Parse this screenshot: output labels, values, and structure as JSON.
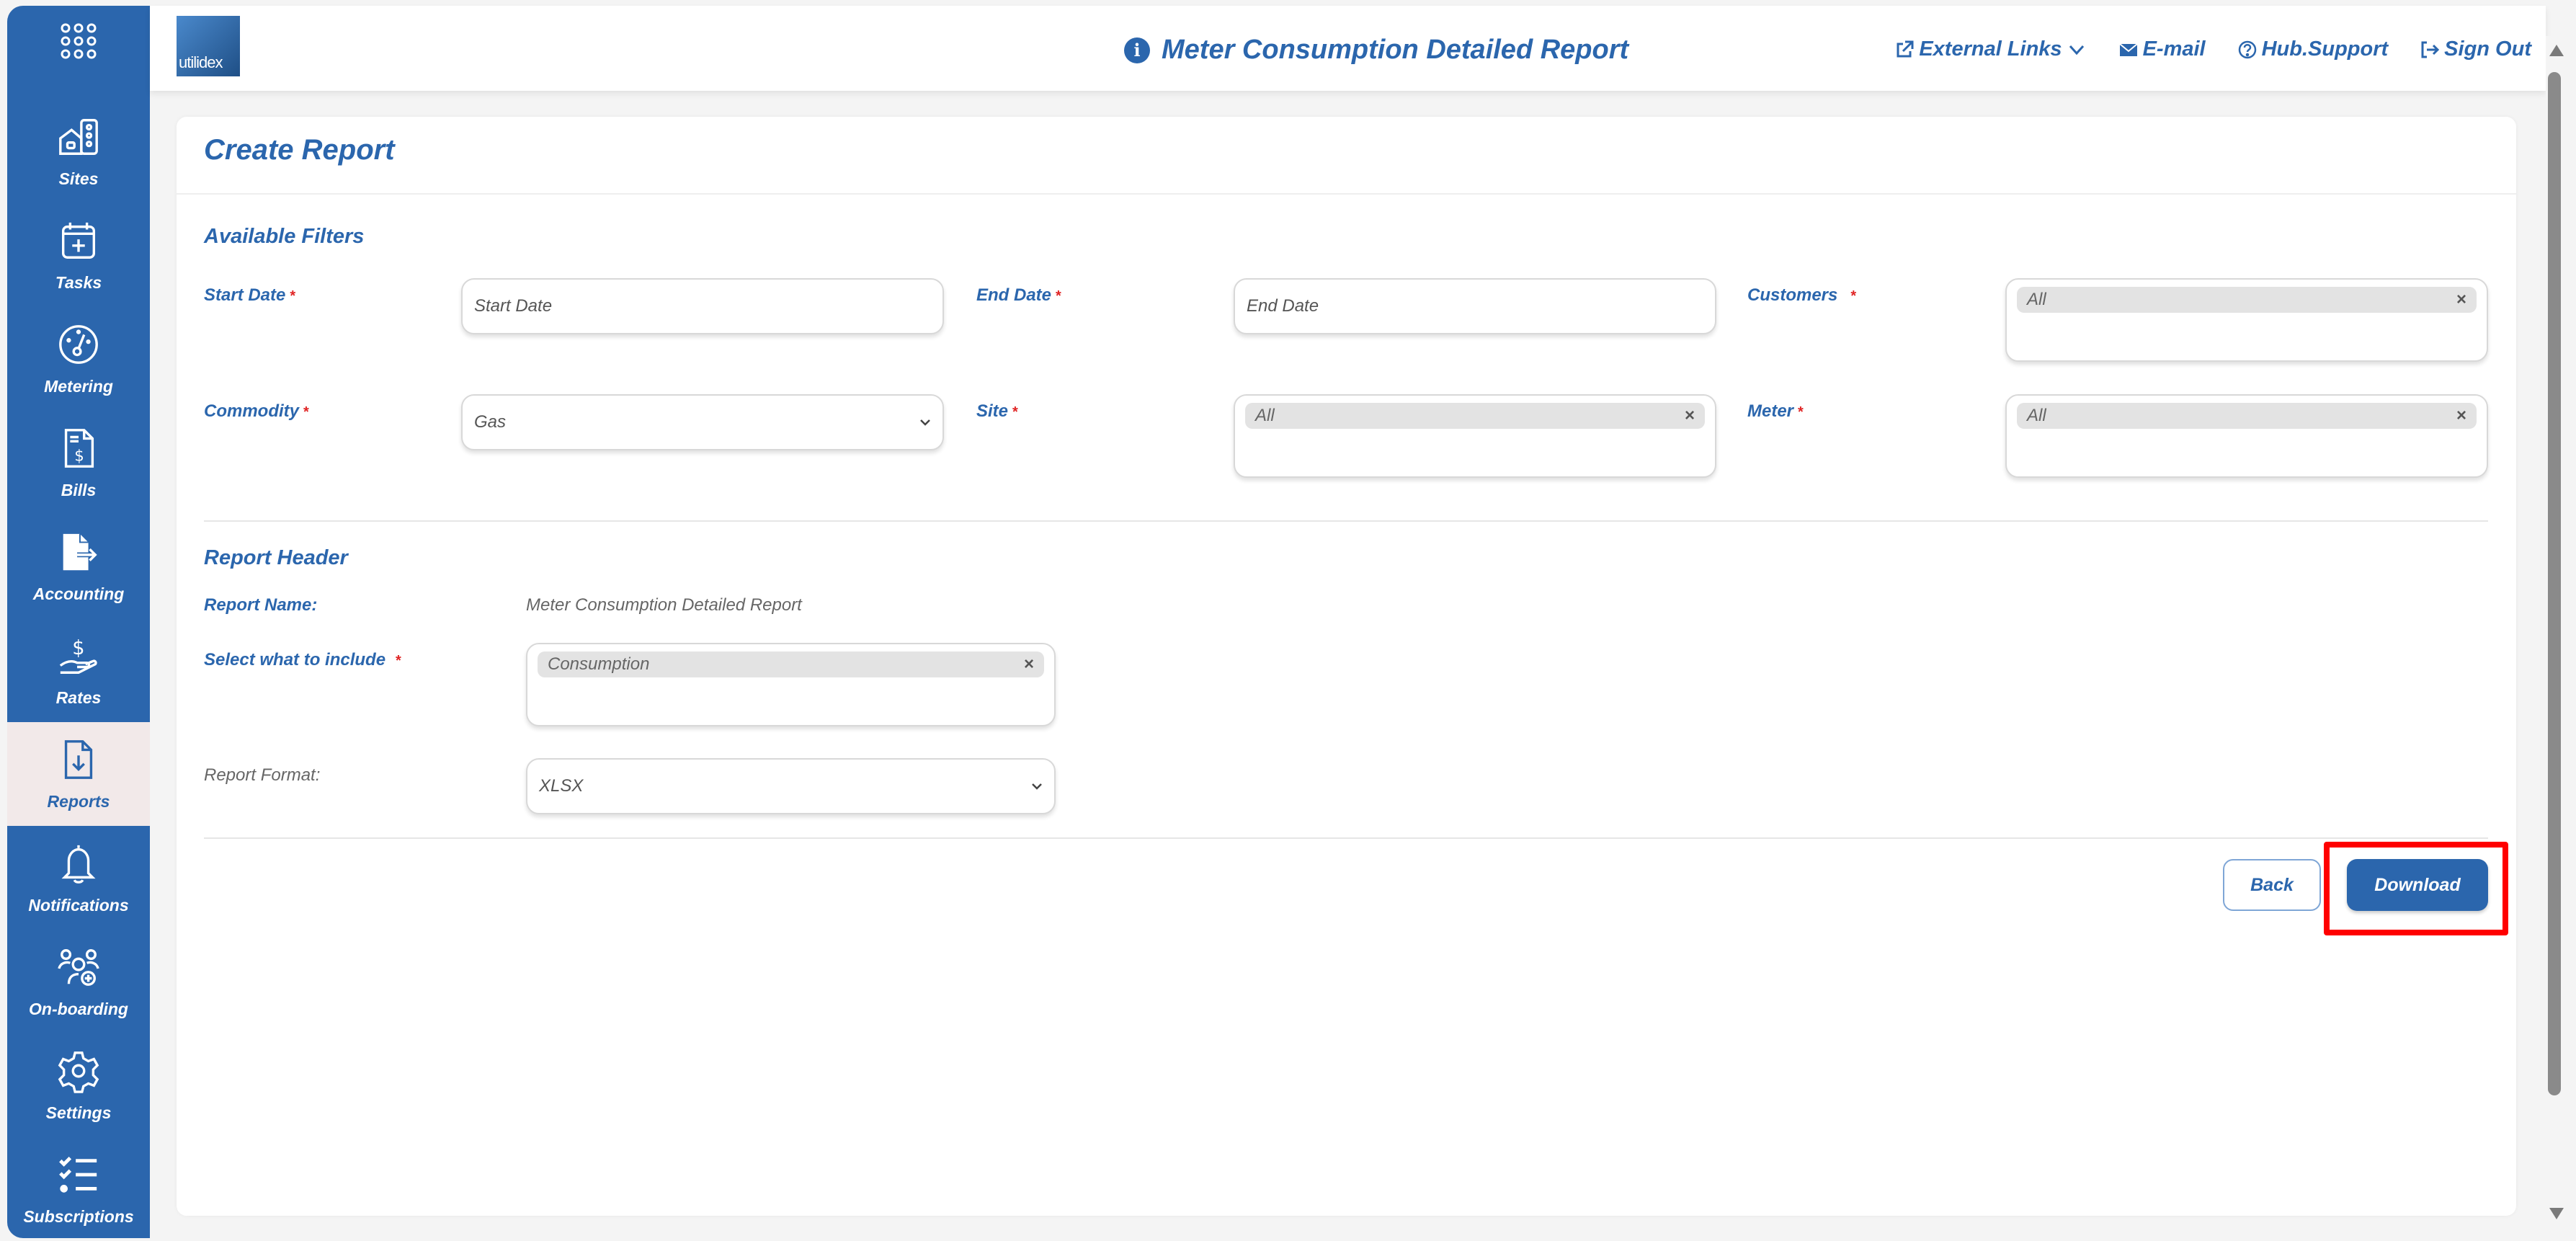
{
  "header": {
    "logo_text": "utilidex",
    "title": "Meter Consumption Detailed Report",
    "links": [
      {
        "label": "External Links",
        "icon": "external-link-icon"
      },
      {
        "label": "E-mail",
        "icon": "envelope-icon"
      },
      {
        "label": "Hub.Support",
        "icon": "question-circle-icon"
      },
      {
        "label": "Sign Out",
        "icon": "sign-out-icon"
      }
    ]
  },
  "sidebar": {
    "items": [
      {
        "label": "Sites",
        "icon": "sites-icon"
      },
      {
        "label": "Tasks",
        "icon": "calendar-plus-icon"
      },
      {
        "label": "Metering",
        "icon": "gauge-icon"
      },
      {
        "label": "Bills",
        "icon": "bill-icon"
      },
      {
        "label": "Accounting",
        "icon": "file-export-icon"
      },
      {
        "label": "Rates",
        "icon": "hand-dollar-icon"
      },
      {
        "label": "Reports",
        "icon": "file-download-icon",
        "active": true
      },
      {
        "label": "Notifications",
        "icon": "bell-icon"
      },
      {
        "label": "On-boarding",
        "icon": "users-plus-icon"
      },
      {
        "label": "Settings",
        "icon": "gear-icon"
      },
      {
        "label": "Subscriptions",
        "icon": "checklist-icon"
      }
    ]
  },
  "card": {
    "title": "Create Report",
    "filters": {
      "section_title": "Available Filters",
      "start_date": {
        "label": "Start Date",
        "placeholder": "Start Date"
      },
      "end_date": {
        "label": "End Date",
        "placeholder": "End Date"
      },
      "customers": {
        "label": "Customers",
        "chip": "All"
      },
      "commodity": {
        "label": "Commodity",
        "value": "Gas"
      },
      "site": {
        "label": "Site",
        "chip": "All"
      },
      "meter": {
        "label": "Meter",
        "chip": "All"
      },
      "required_mark": "*"
    },
    "report_header": {
      "section_title": "Report Header",
      "report_name_label": "Report Name:",
      "report_name_value": "Meter Consumption Detailed Report",
      "include_label": "Select what to include",
      "include_chip": "Consumption",
      "format_label": "Report Format:",
      "format_value": "XLSX"
    },
    "buttons": {
      "back": "Back",
      "download": "Download"
    },
    "chip_remove": "×"
  },
  "colors": {
    "brand": "#2b66ad",
    "required": "#e02424",
    "highlight": "#ff0000"
  }
}
